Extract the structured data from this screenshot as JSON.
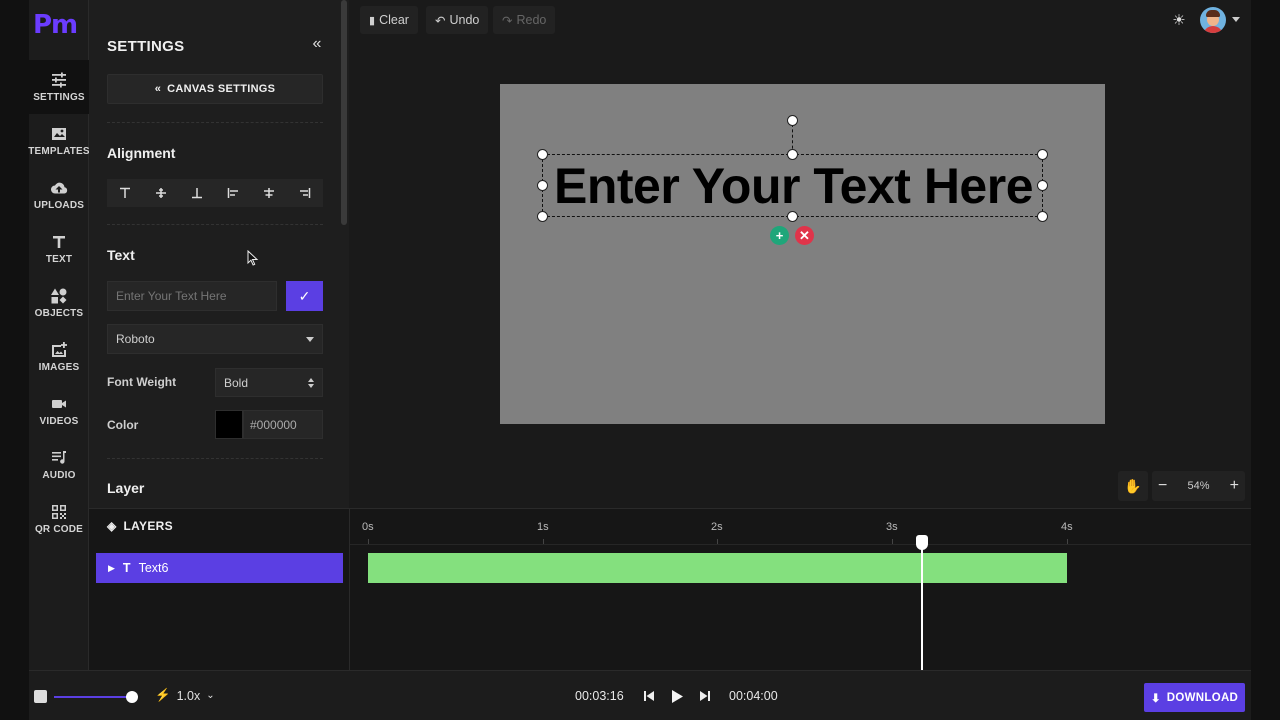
{
  "brand": {
    "logo_text": "Pm"
  },
  "nav": {
    "items": [
      {
        "label": "SETTINGS",
        "icon": "sliders-icon"
      },
      {
        "label": "TEMPLATES",
        "icon": "templates-icon"
      },
      {
        "label": "UPLOADS",
        "icon": "cloud-upload-icon"
      },
      {
        "label": "TEXT",
        "icon": "text-icon"
      },
      {
        "label": "OBJECTS",
        "icon": "shapes-icon"
      },
      {
        "label": "IMAGES",
        "icon": "add-image-icon"
      },
      {
        "label": "VIDEOS",
        "icon": "video-camera-icon"
      },
      {
        "label": "AUDIO",
        "icon": "music-list-icon"
      },
      {
        "label": "QR CODE",
        "icon": "qr-code-icon"
      }
    ]
  },
  "settings": {
    "title": "SETTINGS",
    "canvas_settings_label": "CANVAS SETTINGS",
    "alignment_title": "Alignment",
    "text_title": "Text",
    "text_input_placeholder": "Enter Your Text Here",
    "font_family": "Roboto",
    "font_weight_label": "Font Weight",
    "font_weight_value": "Bold",
    "color_label": "Color",
    "color_value": "#000000",
    "layer_title": "Layer"
  },
  "toolbar": {
    "clear_label": "Clear",
    "undo_label": "Undo",
    "redo_label": "Redo"
  },
  "canvas": {
    "text": "Enter Your Text Here",
    "background_color": "#808080",
    "text_color": "#000000"
  },
  "zoom": {
    "value": "54%"
  },
  "timeline": {
    "layers_title": "LAYERS",
    "layer_name": "Text6",
    "ticks": [
      "0s",
      "1s",
      "2s",
      "3s",
      "4s"
    ],
    "clip_color": "#84e07e",
    "playhead_fraction": 0.79
  },
  "playback": {
    "speed": "1.0x",
    "current_time": "00:03:16",
    "total_time": "00:04:00"
  },
  "download_label": "DOWNLOAD",
  "colors": {
    "accent": "#5b3fe3",
    "logo": "#6b3cff",
    "add": "#1fa67a",
    "remove": "#e0344a"
  }
}
